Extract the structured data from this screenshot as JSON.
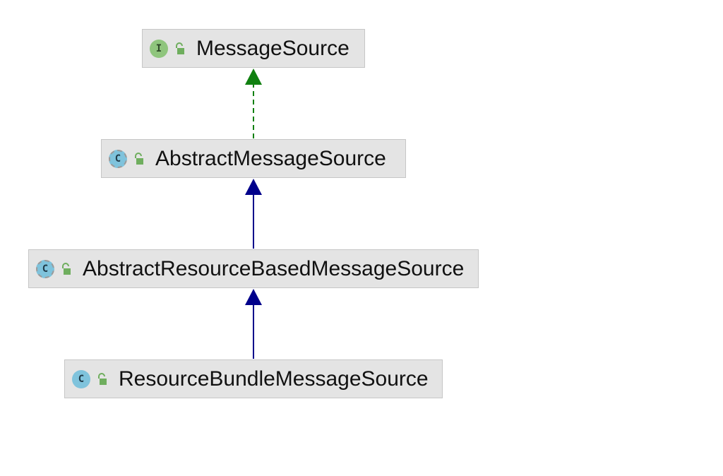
{
  "diagram": {
    "nodes": [
      {
        "id": "message-source",
        "kind": "interface",
        "icon_letter": "I",
        "label": "MessageSource",
        "visibility": "public"
      },
      {
        "id": "abstract-message-source",
        "kind": "abstract-class",
        "icon_letter": "C",
        "label": "AbstractMessageSource",
        "visibility": "public"
      },
      {
        "id": "abstract-resource-based-message-source",
        "kind": "abstract-class",
        "icon_letter": "C",
        "label": "AbstractResourceBasedMessageSource",
        "visibility": "public"
      },
      {
        "id": "resource-bundle-message-source",
        "kind": "class",
        "icon_letter": "C",
        "label": "ResourceBundleMessageSource",
        "visibility": "public"
      }
    ],
    "edges": [
      {
        "from": "abstract-message-source",
        "to": "message-source",
        "type": "implements",
        "style": "dashed",
        "color": "#108010"
      },
      {
        "from": "abstract-resource-based-message-source",
        "to": "abstract-message-source",
        "type": "extends",
        "style": "solid",
        "color": "#00008b"
      },
      {
        "from": "resource-bundle-message-source",
        "to": "abstract-resource-based-message-source",
        "type": "extends",
        "style": "solid",
        "color": "#00008b"
      }
    ]
  }
}
